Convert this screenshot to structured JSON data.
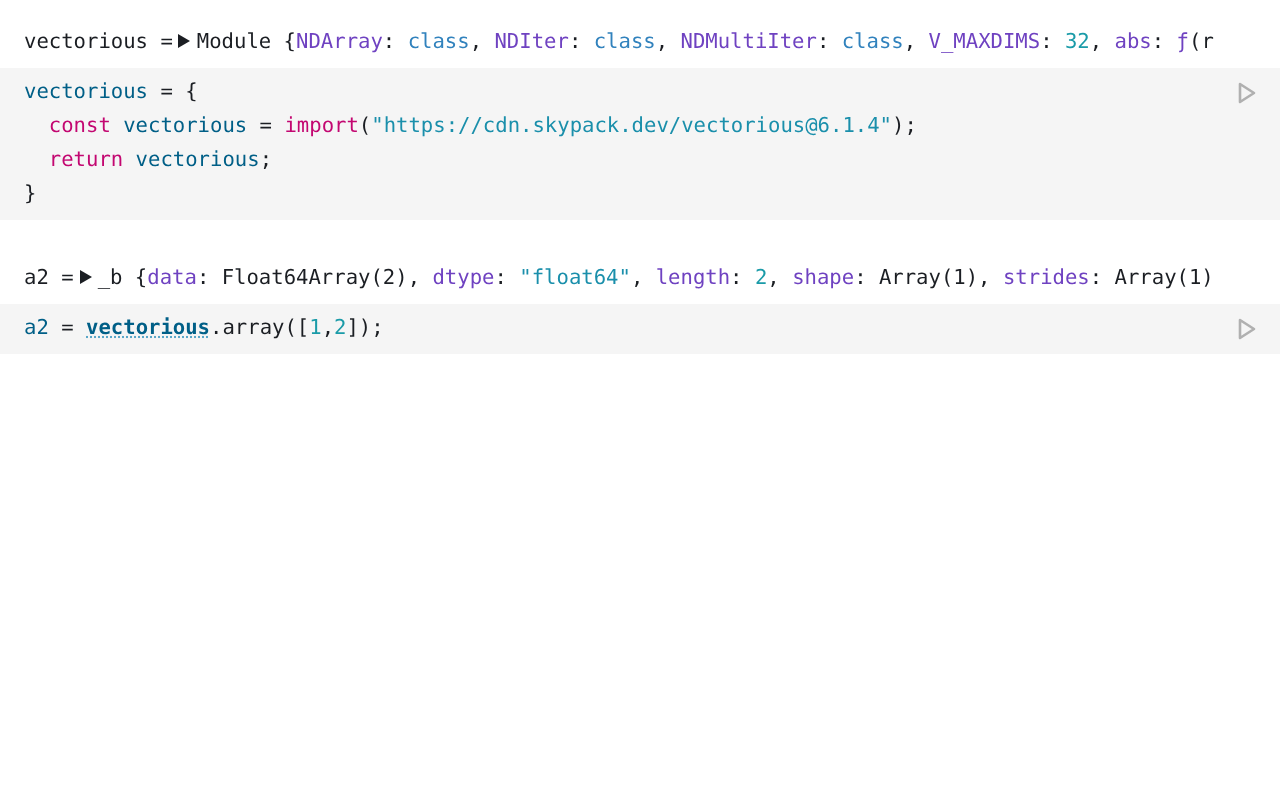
{
  "cells": [
    {
      "output": {
        "label": "vectorious =",
        "expandable": true,
        "tokens": [
          {
            "text": "Module {",
            "kind": "plain"
          },
          {
            "text": "NDArray",
            "kind": "prop"
          },
          {
            "text": ": ",
            "kind": "plain"
          },
          {
            "text": "class",
            "kind": "type"
          },
          {
            "text": ", ",
            "kind": "plain"
          },
          {
            "text": "NDIter",
            "kind": "prop"
          },
          {
            "text": ": ",
            "kind": "plain"
          },
          {
            "text": "class",
            "kind": "type"
          },
          {
            "text": ", ",
            "kind": "plain"
          },
          {
            "text": "NDMultiIter",
            "kind": "prop"
          },
          {
            "text": ": ",
            "kind": "plain"
          },
          {
            "text": "class",
            "kind": "type"
          },
          {
            "text": ", ",
            "kind": "plain"
          },
          {
            "text": "V_MAXDIMS",
            "kind": "prop"
          },
          {
            "text": ": ",
            "kind": "plain"
          },
          {
            "text": "32",
            "kind": "number"
          },
          {
            "text": ", ",
            "kind": "plain"
          },
          {
            "text": "abs",
            "kind": "prop"
          },
          {
            "text": ": ",
            "kind": "plain"
          },
          {
            "text": "ƒ",
            "kind": "prop"
          },
          {
            "text": "(r",
            "kind": "plain"
          }
        ]
      },
      "code": [
        [
          {
            "text": "vectorious",
            "kind": "var"
          },
          {
            "text": " = {",
            "kind": "plain"
          }
        ],
        [
          {
            "text": "  const",
            "kind": "keyword"
          },
          {
            "text": " vectorious",
            "kind": "var"
          },
          {
            "text": " = ",
            "kind": "plain"
          },
          {
            "text": "import",
            "kind": "keyword"
          },
          {
            "text": "(",
            "kind": "plain"
          },
          {
            "text": "\"https://cdn.skypack.dev/vectorious@6.1.4\"",
            "kind": "string"
          },
          {
            "text": ");",
            "kind": "plain"
          }
        ],
        [
          {
            "text": "  return",
            "kind": "keyword"
          },
          {
            "text": " vectorious",
            "kind": "var"
          },
          {
            "text": ";",
            "kind": "plain"
          }
        ],
        [
          {
            "text": "}",
            "kind": "plain"
          }
        ]
      ]
    },
    {
      "output": {
        "label": "a2 =",
        "expandable": true,
        "tokens": [
          {
            "text": "_b {",
            "kind": "plain"
          },
          {
            "text": "data",
            "kind": "prop"
          },
          {
            "text": ": Float64Array(2), ",
            "kind": "plain"
          },
          {
            "text": "dtype",
            "kind": "prop"
          },
          {
            "text": ": ",
            "kind": "plain"
          },
          {
            "text": "\"float64\"",
            "kind": "string"
          },
          {
            "text": ", ",
            "kind": "plain"
          },
          {
            "text": "length",
            "kind": "prop"
          },
          {
            "text": ": ",
            "kind": "plain"
          },
          {
            "text": "2",
            "kind": "number"
          },
          {
            "text": ", ",
            "kind": "plain"
          },
          {
            "text": "shape",
            "kind": "prop"
          },
          {
            "text": ": Array(1), ",
            "kind": "plain"
          },
          {
            "text": "strides",
            "kind": "prop"
          },
          {
            "text": ": Array(1)",
            "kind": "plain"
          }
        ]
      },
      "code": [
        [
          {
            "text": "a2",
            "kind": "var"
          },
          {
            "text": " = ",
            "kind": "plain"
          },
          {
            "text": "vectorious",
            "kind": "ref"
          },
          {
            "text": ".array([",
            "kind": "plain"
          },
          {
            "text": "1",
            "kind": "number"
          },
          {
            "text": ",",
            "kind": "plain"
          },
          {
            "text": "2",
            "kind": "number"
          },
          {
            "text": "]);",
            "kind": "plain"
          }
        ]
      ]
    }
  ]
}
